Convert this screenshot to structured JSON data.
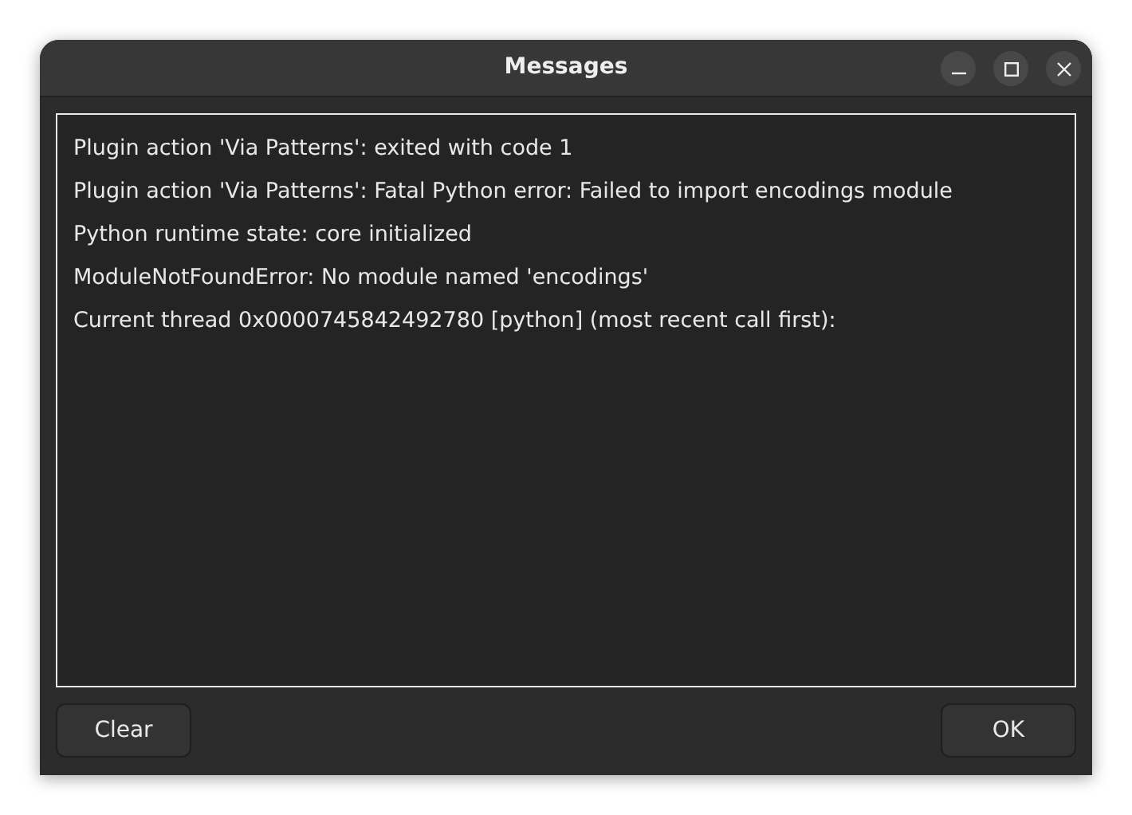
{
  "window": {
    "title": "Messages"
  },
  "messages": [
    "Plugin action 'Via Patterns': exited with code 1",
    "Plugin action 'Via Patterns': Fatal Python error: Failed to import encodings module",
    "Python runtime state: core initialized",
    "ModuleNotFoundError: No module named 'encodings'",
    "Current thread 0x0000745842492780 [python] (most recent call first):"
  ],
  "buttons": [
    {
      "label": "Clear"
    },
    {
      "label": "OK"
    }
  ]
}
